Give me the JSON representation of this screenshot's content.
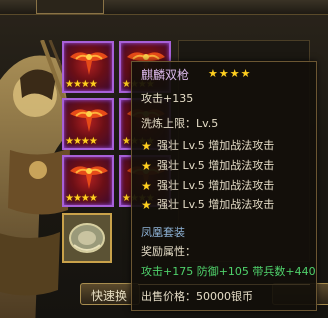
{
  "header": {
    "tab_label": ""
  },
  "slots": [
    {
      "stars": "★★★★"
    },
    {
      "stars": "★★★★"
    },
    {
      "stars": "★★★★"
    },
    {
      "stars": "★★★★"
    },
    {
      "stars": "★★★★"
    },
    {
      "stars": "★★★★"
    }
  ],
  "quick_button_label": "快速换",
  "tooltip": {
    "name": "麒麟双枪",
    "rating_stars": "★★★★",
    "attack": "攻击+135",
    "wash_limit": "洗炼上限：Lv.5",
    "bonuses": [
      "强壮 Lv.5 增加战法攻击",
      "强壮 Lv.5 增加战法攻击",
      "强壮 Lv.5 增加战法攻击",
      "强壮 Lv.5 增加战法攻击"
    ],
    "set_name": "凤凰套装",
    "reward_label": "奖励属性：",
    "reward_values": "攻击+175 防御+105 带兵数+440",
    "price": "出售价格：50000银币"
  },
  "colors": {
    "item_border": "#a760d8",
    "star": "#ffcf1f",
    "set_name": "#8fb4d8",
    "reward": "#4fd26b"
  },
  "icons": [
    "phoenix-item-icon",
    "shield-item-icon",
    "star-icon",
    "general-figure-icon"
  ]
}
